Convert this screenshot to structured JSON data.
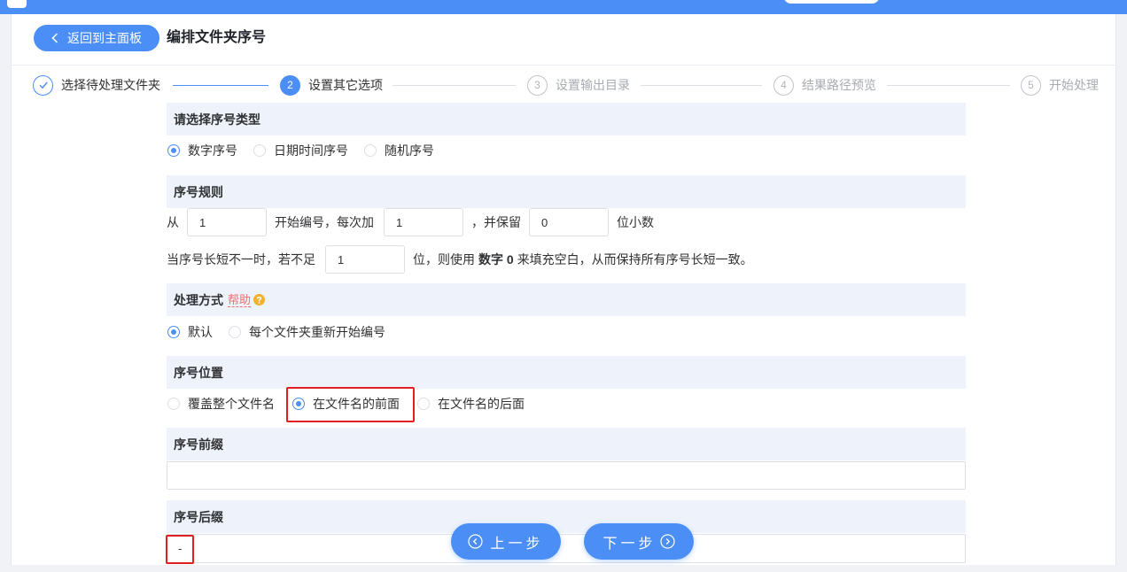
{
  "theme": {
    "accent_color": "#4b8ef5",
    "highlight_color": "#e02020"
  },
  "header": {
    "back_label": "返回到主面板",
    "back_icon": "chevron-left-icon",
    "title": "编排文件夹序号"
  },
  "steps": [
    {
      "icon": "check-icon",
      "label": "选择待处理文件夹",
      "completed": true,
      "current": false
    },
    {
      "number": "2",
      "label": "设置其它选项",
      "completed": false,
      "current": true
    },
    {
      "number": "3",
      "label": "设置输出目录",
      "completed": false,
      "current": false
    },
    {
      "number": "4",
      "label": "结果路径预览",
      "completed": false,
      "current": false
    },
    {
      "number": "5",
      "label": "开始处理",
      "completed": false,
      "current": false
    }
  ],
  "serial_type": {
    "title": "请选择序号类型",
    "options": [
      {
        "label": "数字序号",
        "checked": true
      },
      {
        "label": "日期时间序号",
        "checked": false
      },
      {
        "label": "随机序号",
        "checked": false
      }
    ]
  },
  "serial_rule": {
    "title": "序号规则",
    "from_label": "从",
    "start_value": "1",
    "step_label": "开始编号，每次加",
    "step_value": "1",
    "decimals_label": "，并保留",
    "decimals_value": "0",
    "decimals_suffix": "位小数",
    "pad_label": "当序号长短不一时，若不足",
    "pad_value": "1",
    "pad_mid": "位，则使用",
    "pad_bold": "数字 0",
    "pad_suffix": "来填充空白，从而保持所有序号长短一致。"
  },
  "process_mode": {
    "title": "处理方式",
    "help_label": "帮助",
    "help_icon": "question-circle-icon",
    "options": [
      {
        "label": "默认",
        "checked": true
      },
      {
        "label": "每个文件夹重新开始编号",
        "checked": false
      }
    ]
  },
  "serial_position": {
    "title": "序号位置",
    "options": [
      {
        "label": "覆盖整个文件名",
        "checked": false
      },
      {
        "label": "在文件名的前面",
        "checked": true
      },
      {
        "label": "在文件名的后面",
        "checked": false
      }
    ]
  },
  "prefix": {
    "title": "序号前缀",
    "value": ""
  },
  "suffix": {
    "title": "序号后缀",
    "value": "-"
  },
  "nav": {
    "prev_label": "上一步",
    "prev_icon": "circle-chevron-left-icon",
    "next_label": "下一步",
    "next_icon": "circle-chevron-right-icon"
  }
}
